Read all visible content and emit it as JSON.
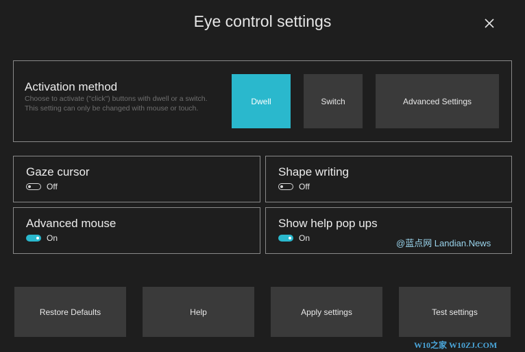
{
  "window": {
    "title": "Eye control settings",
    "close_icon": "close-icon"
  },
  "activation": {
    "title": "Activation method",
    "description": "Choose to activate (\"click\") buttons with dwell or a switch. This setting can only be changed with mouse or touch.",
    "options": [
      {
        "label": "Dwell",
        "selected": true
      },
      {
        "label": "Switch",
        "selected": false
      },
      {
        "label": "Advanced Settings",
        "selected": false
      }
    ]
  },
  "settings": {
    "gaze_cursor": {
      "title": "Gaze cursor",
      "state_label": "Off",
      "enabled": false
    },
    "shape_writing": {
      "title": "Shape writing",
      "state_label": "Off",
      "enabled": false
    },
    "advanced_mouse": {
      "title": "Advanced mouse",
      "state_label": "On",
      "enabled": true
    },
    "help_popups": {
      "title": "Show help pop ups",
      "state_label": "On",
      "enabled": true
    }
  },
  "buttons": {
    "restore_defaults": "Restore Defaults",
    "help": "Help",
    "apply": "Apply settings",
    "test": "Test settings"
  },
  "watermarks": {
    "landian": "@蓝点网 Landian.News",
    "w10": "W10之家 W10ZJ.COM"
  },
  "colors": {
    "background": "#1e1e1e",
    "accent": "#2ab8cd",
    "button": "#3a3a3a",
    "border": "#8a8a8a",
    "description_text": "#6f6f6f"
  }
}
